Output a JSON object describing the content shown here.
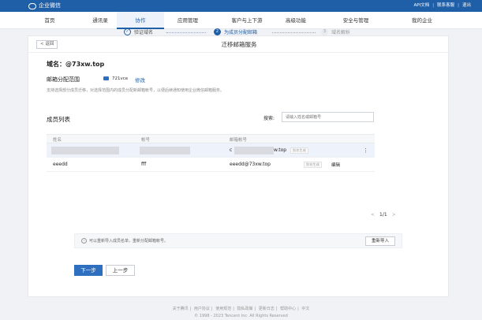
{
  "topbar": {
    "app_name": "企业微信",
    "links": [
      "API文档",
      "联系客服",
      "退出"
    ]
  },
  "nav": {
    "tabs": [
      "首页",
      "通讯录",
      "协作",
      "应用管理",
      "客户与上下游",
      "高级功能",
      "安全与管理",
      "我的企业"
    ],
    "active": "协作"
  },
  "panel": {
    "back_label": "< 返回",
    "title": "迁移邮箱服务"
  },
  "steps": [
    {
      "num": "✓",
      "label": "验证域名",
      "state": "done"
    },
    {
      "num": "2",
      "label": "为成员分配邮箱",
      "state": "current"
    },
    {
      "num": "3",
      "label": "域名解析",
      "state": "todo"
    }
  ],
  "domain_label": "域名：@73xw.top",
  "range": {
    "label": "邮箱分配范围",
    "value": "721vce",
    "modify": "修改",
    "hint": "支持选择部分成员迁移，对选择范围内的成员分配新邮箱帐号，以便后续通知使用企业微信邮箱服务。"
  },
  "members": {
    "title": "成员列表",
    "search_label": "搜索:",
    "search_placeholder": "请输入姓名或邮箱号",
    "columns": [
      "姓名",
      "帐号",
      "邮箱帐号"
    ],
    "rows": [
      {
        "name": "",
        "account": "",
        "email_prefix": "c",
        "email_suffix": "w.top",
        "tag": "别名生成"
      },
      {
        "name": "eeedd",
        "account": "fff",
        "email": "eeedd@73xw.top",
        "tag": "别名生成",
        "action": "编辑"
      }
    ]
  },
  "pager": {
    "prev": "<",
    "page": "1/1",
    "next": ">"
  },
  "import": {
    "info": "i",
    "text": "可以重新导入成员名单，重新分配邮箱帐号。",
    "button": "重新导入"
  },
  "actions": {
    "next": "下一步",
    "prev": "上一步"
  },
  "footer": {
    "links": [
      "关于腾讯",
      "用户协议",
      "使用规范",
      "隐私政策",
      "更新日志",
      "帮助中心",
      "中文"
    ],
    "copyright": "© 1998 - 2023 Tencent Inc. All Rights Reserved"
  },
  "colors": {
    "brand": "#1f5fa8",
    "primary_button": "#2f6fbf"
  }
}
